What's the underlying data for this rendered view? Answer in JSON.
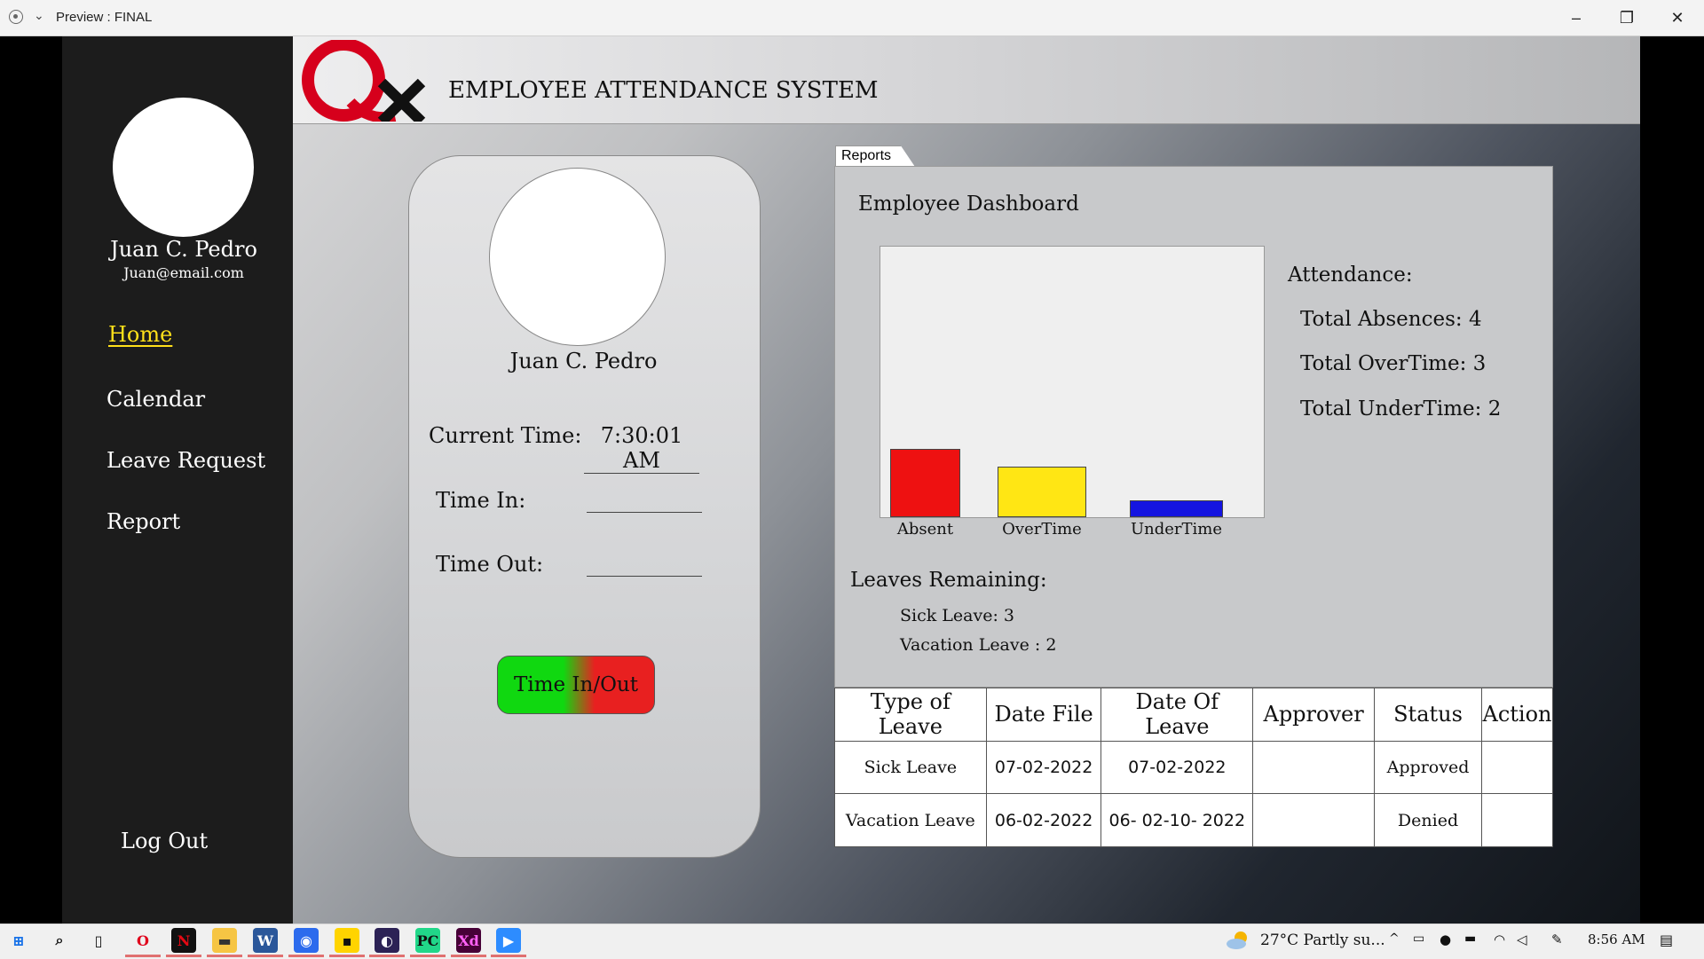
{
  "window": {
    "title": "Preview : FINAL"
  },
  "header": {
    "logo_text": "Qx",
    "system_title": "EMPLOYEE ATTENDANCE SYSTEM"
  },
  "sidebar": {
    "user_name": "Juan C. Pedro",
    "user_email": "Juan@email.com",
    "nav": [
      "Home",
      "Calendar",
      "Leave Request",
      "Report"
    ],
    "active": "Home",
    "logout": "Log Out"
  },
  "time_card": {
    "user_name": "Juan C. Pedro",
    "current_time_label": "Current Time:",
    "current_time_value": "7:30:01 AM",
    "time_in_label": "Time In:",
    "time_in_value": "",
    "time_out_label": "Time Out:",
    "time_out_value": "",
    "button_label": "Time In/Out"
  },
  "reports": {
    "tab_label": "Reports",
    "dashboard_title": "Employee Dashboard",
    "attendance_title": "Attendance:",
    "total_absences": "Total Absences: 4",
    "total_overtime": "Total OverTime: 3",
    "total_undertime": "Total UnderTime: 2",
    "leaves_title": "Leaves Remaining:",
    "sick_leave": "Sick Leave: 3",
    "vacation_leave": "Vacation Leave : 2"
  },
  "chart_data": {
    "type": "bar",
    "categories": [
      "Absent",
      "OverTime",
      "UnderTime"
    ],
    "values": [
      4,
      3,
      1
    ],
    "colors": [
      "#ee1111",
      "#ffe614",
      "#1414e0"
    ],
    "ylim": [
      0,
      16
    ]
  },
  "leave_table": {
    "columns": [
      "Type of Leave",
      "Date File",
      "Date Of Leave",
      "Approver",
      "Status",
      "Action"
    ],
    "rows": [
      [
        "Sick Leave",
        "07-02-2022",
        "07-02-2022",
        "",
        "Approved",
        ""
      ],
      [
        "Vacation Leave",
        "06-02-2022",
        "06- 02-10- 2022",
        "",
        "Denied",
        ""
      ]
    ]
  },
  "taskbar": {
    "weather": "27°C  Partly su...",
    "clock": "8:56 AM",
    "apps": [
      "start-icon",
      "search-icon",
      "task-view-icon",
      "opera-icon",
      "netflix-icon",
      "file-explorer-icon",
      "word-icon",
      "signal-icon",
      "sticky-notes-icon",
      "eclipse-icon",
      "pycharm-icon",
      "adobe-xd-icon",
      "zoom-icon"
    ]
  }
}
